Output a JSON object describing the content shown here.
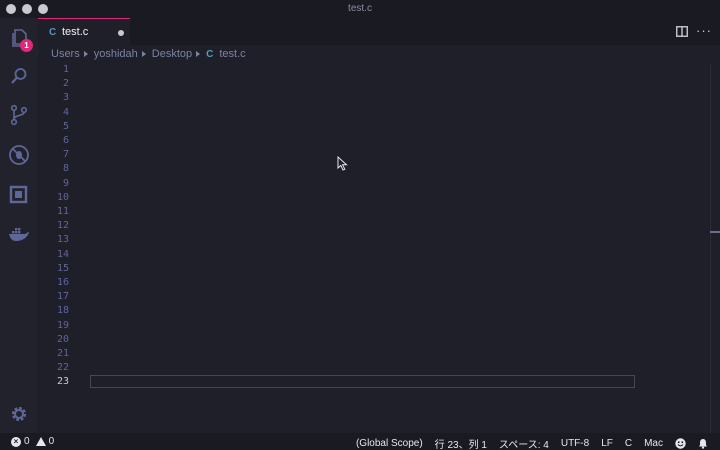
{
  "window": {
    "title": "test.c"
  },
  "activity": {
    "explorer_badge": "1",
    "icons": [
      "files-icon",
      "search-icon",
      "source-control-icon",
      "debug-icon",
      "extensions-icon",
      "docker-icon",
      "gear-icon"
    ]
  },
  "tab": {
    "icon": "C",
    "label": "test.c",
    "modified": true
  },
  "breadcrumb": {
    "items": [
      "Users",
      "yoshidah",
      "Desktop"
    ],
    "file_icon": "C",
    "file": "test.c"
  },
  "editor": {
    "line_numbers": [
      "1",
      "2",
      "3",
      "4",
      "5",
      "6",
      "7",
      "8",
      "9",
      "10",
      "11",
      "12",
      "13",
      "14",
      "15",
      "16",
      "17",
      "18",
      "19",
      "20",
      "21",
      "22",
      "23"
    ],
    "active_line": "23"
  },
  "status": {
    "errors": "0",
    "warnings": "0",
    "scope": "(Global Scope)",
    "position": "行 23、列 1",
    "indent": "スペース: 4",
    "encoding": "UTF-8",
    "eol": "LF",
    "language": "C",
    "platform": "Mac"
  },
  "colors": {
    "accent": "#e0287b",
    "c_icon": "#519aba",
    "background": "#1e1f29"
  }
}
